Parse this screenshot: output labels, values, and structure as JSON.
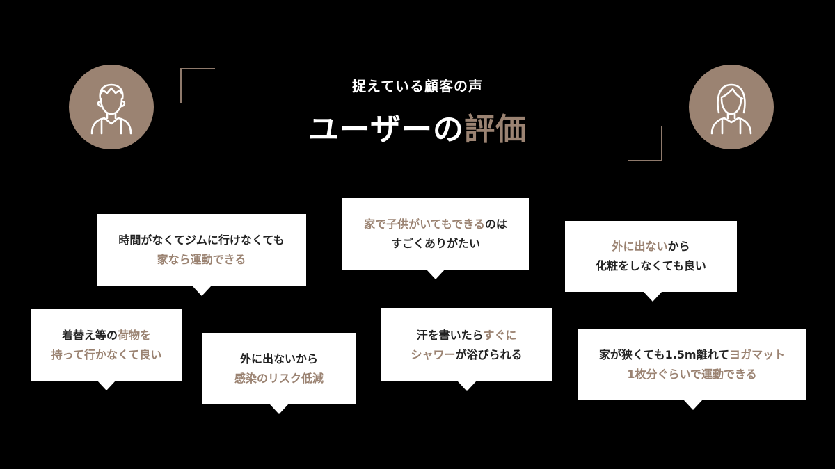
{
  "header": {
    "subtitle": "捉えている顧客の声",
    "title_main": "ユーザーの",
    "title_accent": "評価"
  },
  "colors": {
    "accent": "#9b8372",
    "background": "#000000",
    "bubble": "#ffffff"
  },
  "avatars": {
    "left_icon": "man-avatar-icon",
    "right_icon": "woman-avatar-icon"
  },
  "bubbles": {
    "b1": {
      "line1": "時間がなくてジムに行けなくても",
      "line2_accent": "家なら運動できる"
    },
    "b2": {
      "line1_accent": "家で子供がいてもできる",
      "line1_rest": "のは",
      "line2": "すごくありがたい"
    },
    "b3": {
      "line1_accent": "外に出ない",
      "line1_rest": "から",
      "line2": "化粧をしなくても良い"
    },
    "b4": {
      "line1_pre": "着替え等の",
      "line1_accent": "荷物を",
      "line2_accent": "持って行かなくて良い"
    },
    "b5": {
      "line1": "外に出ないから",
      "line2_accent": "感染のリスク低減"
    },
    "b6": {
      "line1_pre": "汗を書いたら",
      "line1_accent": "すぐに",
      "line2_accent": "シャワー",
      "line2_rest": "が浴びられる"
    },
    "b7": {
      "line1_pre": "家が狭くても1.5m離れて",
      "line1_accent": "ヨガマット",
      "line2_accent": "1枚分ぐらいで運動できる"
    }
  }
}
